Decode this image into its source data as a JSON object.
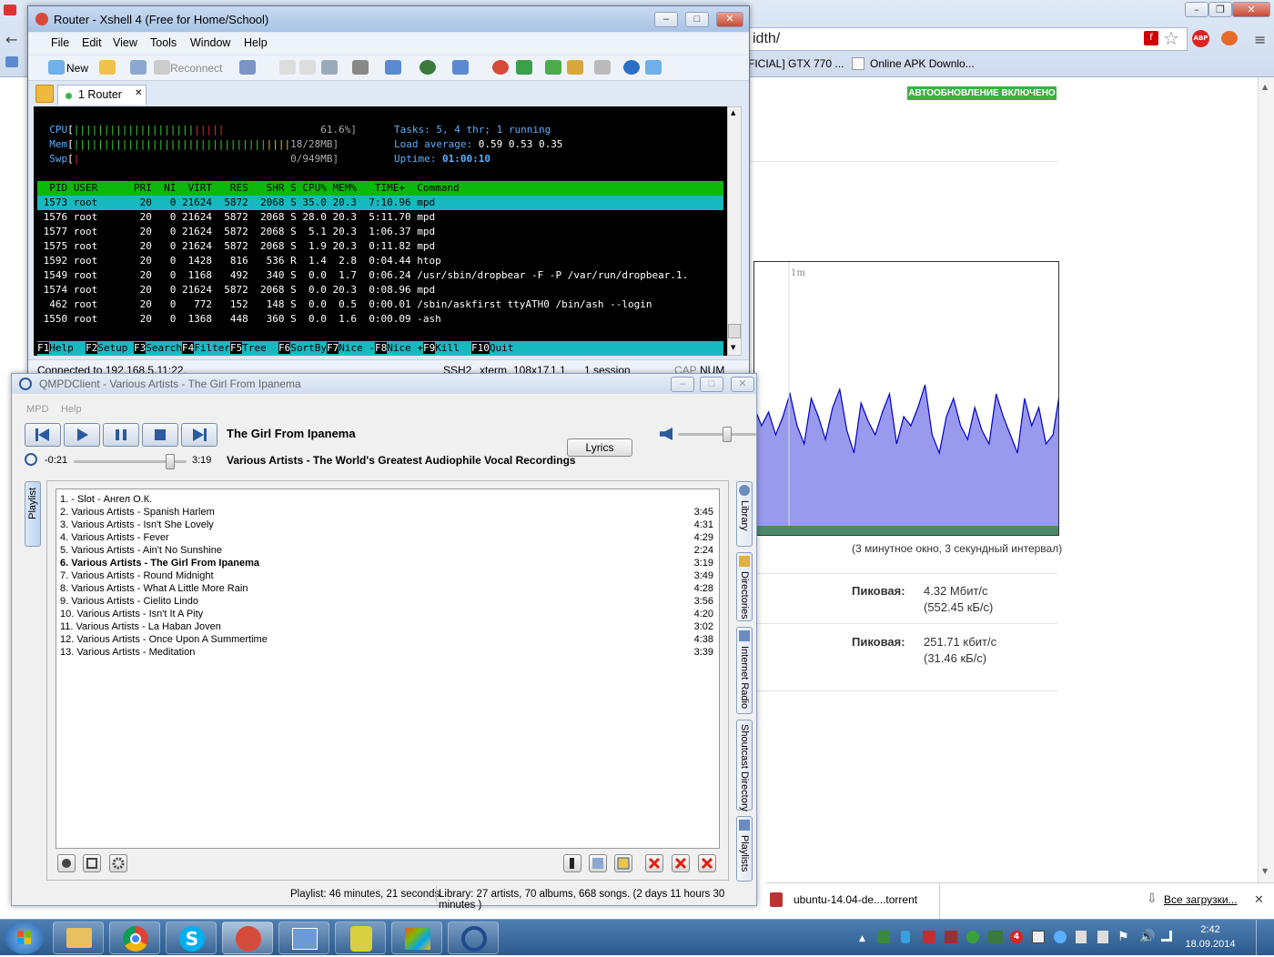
{
  "browser": {
    "address": "idth/",
    "bookmarks": [
      "FICIAL] GTX 770 ...",
      "Online APK Downlo..."
    ],
    "autoupdate_badge": "АВТООБНОВЛЕНИЕ ВКЛЮЧЕНО",
    "graph_axis_label": "1m",
    "graph_caption": "(3 минутное окно, 3 секундный интервал)",
    "peak1": {
      "label": "Пиковая:",
      "value": "4.32 Мбит/с",
      "sub": "(552.45 кБ/с)"
    },
    "peak2": {
      "label": "Пиковая:",
      "value": "251.71 кбит/с",
      "sub": "(31.46 кБ/с)"
    },
    "download": {
      "file": "ubuntu-14.04-de....torrent",
      "all_downloads": "Все загрузки..."
    },
    "icons": [
      "flash-icon",
      "star-icon",
      "adblock-icon"
    ],
    "colors": {
      "graph_fill": "#9999ee",
      "graph_line": "#0000cc",
      "badge": "#3cb043"
    }
  },
  "xshell": {
    "title": "Router - Xshell 4 (Free for Home/School)",
    "menu": [
      "File",
      "Edit",
      "View",
      "Tools",
      "Window",
      "Help"
    ],
    "toolbar": {
      "new": "New",
      "reconnect": "Reconnect"
    },
    "tab": "1 Router",
    "terminal": {
      "cpu": "61.6%]",
      "mem": "18/28MB]",
      "swp": "0/949MB]",
      "tasks_label": "Tasks:",
      "tasks": "5, 4 thr; 1 running",
      "load_label": "Load average:",
      "load": "0.59 0.53 0.35",
      "uptime_label": "Uptime:",
      "uptime": "01:00:10",
      "header": "  PID USER      PRI  NI  VIRT   RES   SHR S CPU% MEM%   TIME+  Command                   ",
      "rows": [
        " 1573 root       20   0 21624  5872  2068 S 35.0 20.3  7:10.96 mpd                       ",
        " 1576 root       20   0 21624  5872  2068 S 28.0 20.3  5:11.70 mpd",
        " 1577 root       20   0 21624  5872  2068 S  5.1 20.3  1:06.37 mpd",
        " 1575 root       20   0 21624  5872  2068 S  1.9 20.3  0:11.82 mpd",
        " 1592 root       20   0  1428   816   536 R  1.4  2.8  0:04.44 htop",
        " 1549 root       20   0  1168   492   340 S  0.0  1.7  0:06.24 /usr/sbin/dropbear -F -P /var/run/dropbear.1.",
        " 1574 root       20   0 21624  5872  2068 S  0.0 20.3  0:08.96 mpd",
        "  462 root       20   0   772   152   148 S  0.0  0.5  0:00.01 /sbin/askfirst ttyATH0 /bin/ash --login",
        " 1550 root       20   0  1368   448   360 S  0.0  1.6  0:00.09 -ash"
      ],
      "fkeys": [
        {
          "k": "F1",
          "l": "Help  "
        },
        {
          "k": "F2",
          "l": "Setup "
        },
        {
          "k": "F3",
          "l": "Search"
        },
        {
          "k": "F4",
          "l": "Filter"
        },
        {
          "k": "F5",
          "l": "Tree  "
        },
        {
          "k": "F6",
          "l": "SortBy"
        },
        {
          "k": "F7",
          "l": "Nice -"
        },
        {
          "k": "F8",
          "l": "Nice +"
        },
        {
          "k": "F9",
          "l": "Kill  "
        },
        {
          "k": "F10",
          "l": "Quit"
        }
      ]
    },
    "status": {
      "connected": "Connected to 192.168.5.11:22.",
      "proto": "SSH2",
      "term": "xterm",
      "size": "108x17",
      "pos": "1,1",
      "sessions": "1 session",
      "cap": "CAP",
      "num": "NUM"
    }
  },
  "qmpd": {
    "title": "QMPDClient - Various Artists - The Girl From Ipanema",
    "menu": [
      "MPD",
      "Help"
    ],
    "song_title": "The Girl From Ipanema",
    "album_line": "Various Artists - The World's Greatest Audiophile Vocal Recordings",
    "elapsed": "-0:21",
    "total": "3:19",
    "progress": 0.89,
    "volume": 0.65,
    "lyrics": "Lyrics",
    "side_tabs": {
      "playlist": "Playlist",
      "library": "Library",
      "directories": "Directories",
      "radio": "Internet Radio",
      "shoutcast": "Shoutcast Directory",
      "playlists": "Playlists"
    },
    "playlist": [
      {
        "n": "1.  - Slot - Ангел О.К.",
        "d": ""
      },
      {
        "n": "2. Various Artists - Spanish Harlem",
        "d": "3:45"
      },
      {
        "n": "3. Various Artists - Isn't She Lovely",
        "d": "4:31"
      },
      {
        "n": "4. Various Artists - Fever",
        "d": "4:29"
      },
      {
        "n": "5. Various Artists - Ain't No Sunshine",
        "d": "2:24"
      },
      {
        "n": "6. Various Artists - The Girl From Ipanema",
        "d": "3:19",
        "current": true
      },
      {
        "n": "7. Various Artists - Round Midnight",
        "d": "3:49"
      },
      {
        "n": "8. Various Artists - What A Little More Rain",
        "d": "4:28"
      },
      {
        "n": "9. Various Artists - Cielito Lindo",
        "d": "3:56"
      },
      {
        "n": "10. Various Artists - Isn't It A Pity",
        "d": "4:20"
      },
      {
        "n": "11. Various Artists - La Haban Joven",
        "d": "3:02"
      },
      {
        "n": "12. Various Artists - Once Upon A Summertime",
        "d": "4:38"
      },
      {
        "n": "13. Various Artists - Meditation",
        "d": "3:39"
      }
    ],
    "status_playlist": "Playlist: 46 minutes, 21 seconds.",
    "status_library": "Library:  27 artists, 70 albums, 668 songs. (2 days 11 hours 30 minutes )"
  },
  "taskbar": {
    "time": "2:42",
    "date": "18.09.2014",
    "tray_count": "4"
  }
}
